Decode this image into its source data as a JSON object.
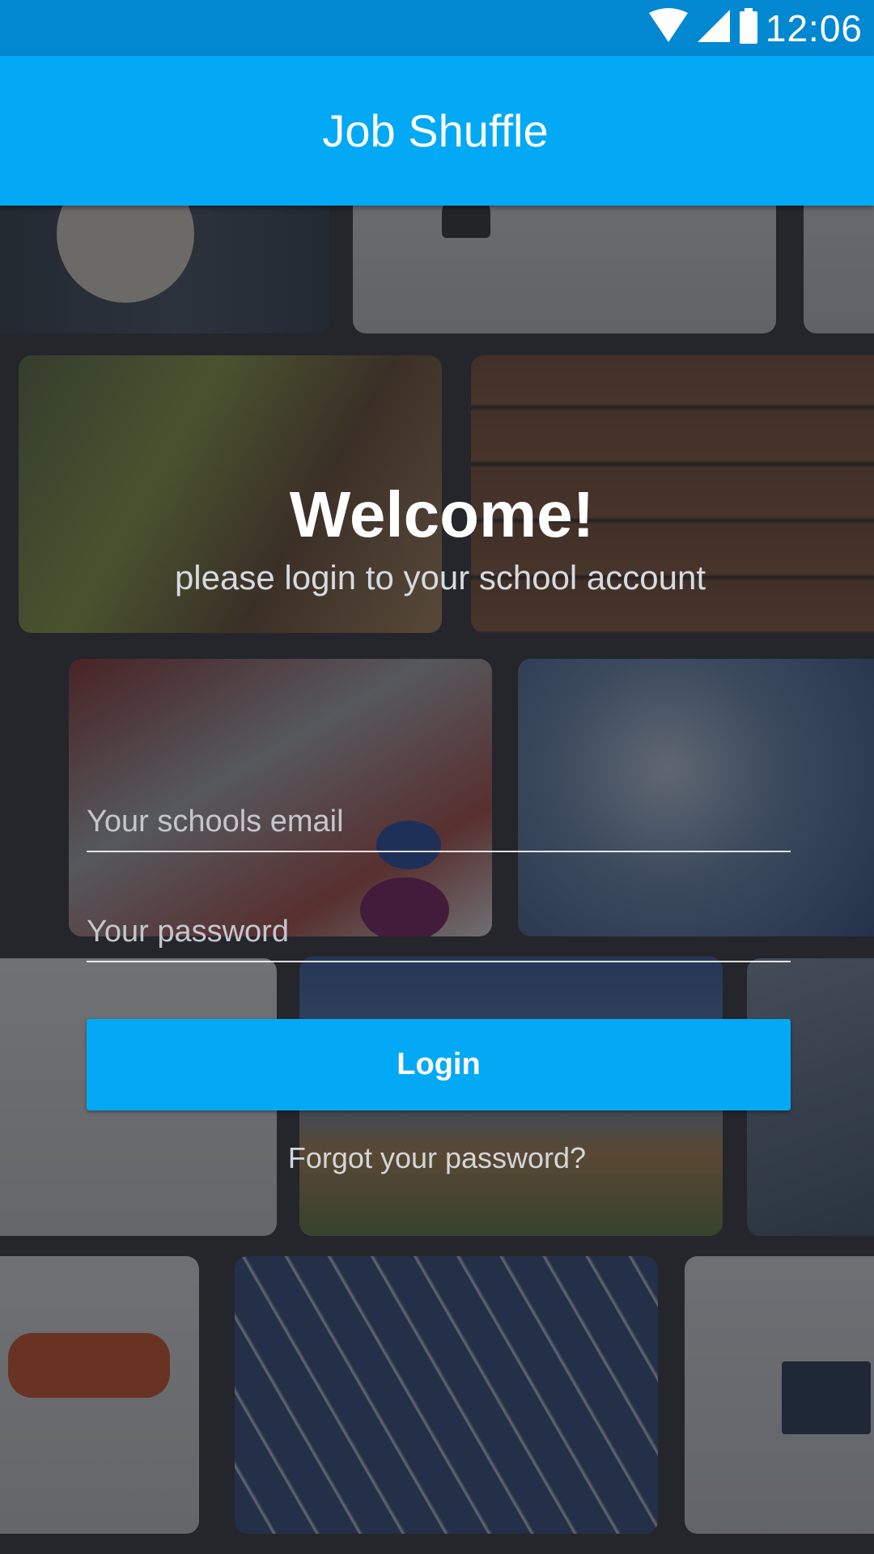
{
  "status_bar": {
    "time": "12:06",
    "icons": [
      "wifi-icon",
      "signal-icon",
      "battery-icon"
    ]
  },
  "app_bar": {
    "title": "Job Shuffle"
  },
  "welcome": {
    "title": "Welcome!",
    "subtitle": "please login to your school account"
  },
  "form": {
    "email": {
      "placeholder": "Your schools email",
      "value": ""
    },
    "password": {
      "placeholder": "Your password",
      "value": ""
    },
    "login_label": "Login",
    "forgot_label": "Forgot your password?"
  },
  "colors": {
    "status_bar": "#0288d1",
    "app_bar": "#03a9f4",
    "button": "#03a9f4"
  }
}
